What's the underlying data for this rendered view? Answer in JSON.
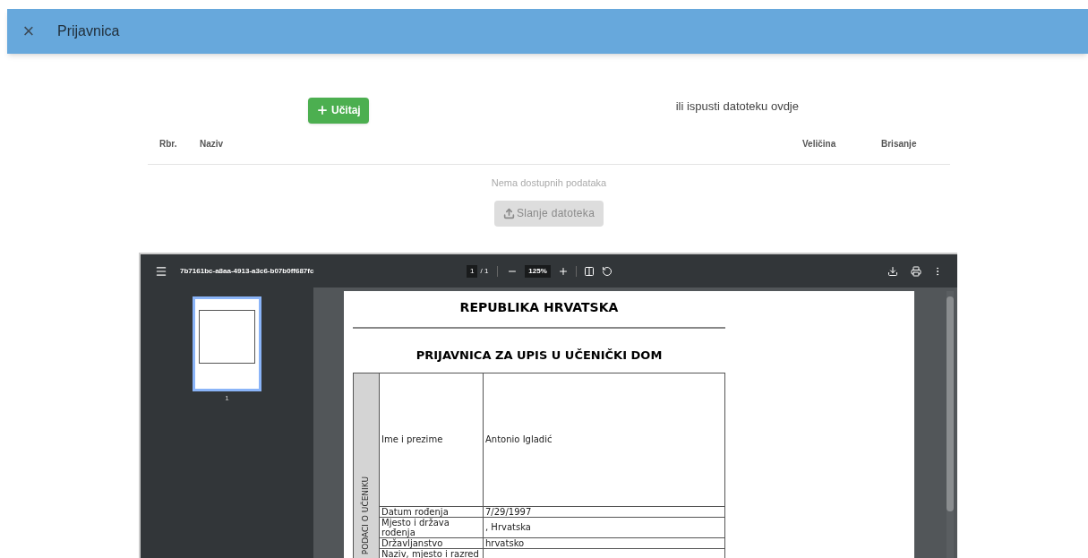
{
  "header": {
    "close": "×",
    "title": "Prijavnica"
  },
  "upload": {
    "button": "Učitaj",
    "drop_hint": "ili ispusti datoteku ovdje"
  },
  "table": {
    "columns": [
      "Rbr.",
      "Naziv",
      "Veličina",
      "Brisanje"
    ],
    "empty": "Nema dostupnih podataka"
  },
  "send_button": {
    "label": "Slanje datoteka",
    "disabled": true
  },
  "viewer": {
    "filename": "7b7161bc-a8aa-4913-a3c6-b07b0ff687fc",
    "page": "1",
    "pages": "/ 1",
    "zoom": "125%",
    "thumbnails": [
      {
        "label": "1",
        "selected": true
      }
    ],
    "document": {
      "heading": "REPUBLIKA HRVATSKA",
      "title": "PRIJAVNICA ZA UPIS U UČENIČKI DOM",
      "section": "PODACI O UČENIKU",
      "rows": [
        {
          "label": "Ime i prezime",
          "value": "Antonio Igladić",
          "tall": true
        },
        {
          "label": "Datum rođenja",
          "value": "7/29/1997",
          "tall": false
        },
        {
          "label": "Mjesto i država rođenja",
          "value": ", Hrvatska",
          "tall": false
        },
        {
          "label": "Državljanstvo",
          "value": "hrvatsko",
          "tall": false
        },
        {
          "label": "Naziv, mjesto i razred",
          "value": "",
          "tall": false
        }
      ]
    }
  }
}
